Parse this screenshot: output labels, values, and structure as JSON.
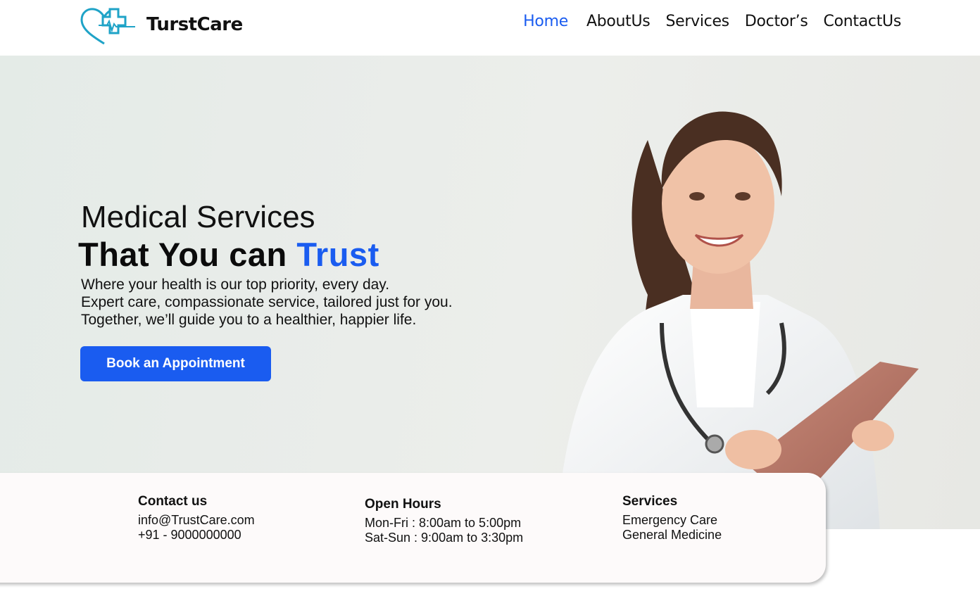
{
  "brand": {
    "name": "TurstCare",
    "logo_icon": "heart-cross-pulse-icon",
    "accent": "#1a5cf0",
    "logo_color": "#1fa3c7"
  },
  "nav": {
    "items": [
      {
        "label": "Home",
        "active": true
      },
      {
        "label": "AboutUs"
      },
      {
        "label": "Services"
      },
      {
        "label": "Doctor’s"
      },
      {
        "label": "ContactUs"
      }
    ]
  },
  "hero": {
    "subtitle": "Medical Services",
    "title_main": "That You can ",
    "title_accent": "Trust",
    "description": [
      "Where your health is our top priority, every day.",
      "Expert care, compassionate service, tailored just for you.",
      "Together, we’ll guide you to a healthier, happier life."
    ],
    "cta_label": "Book an Appointment",
    "image": "smiling-doctor-with-stethoscope-and-tablet"
  },
  "info": {
    "contact": {
      "title": "Contact us",
      "email": "info@TrustCare.com",
      "phone": " +91 - 9000000000"
    },
    "hours": {
      "title": "Open Hours",
      "weekdays": "Mon-Fri : 8:00am to 5:00pm",
      "weekend": "Sat-Sun : 9:00am to 3:30pm"
    },
    "services": {
      "title": "Services",
      "items": [
        "Emergency Care",
        "General Medicine"
      ]
    }
  }
}
